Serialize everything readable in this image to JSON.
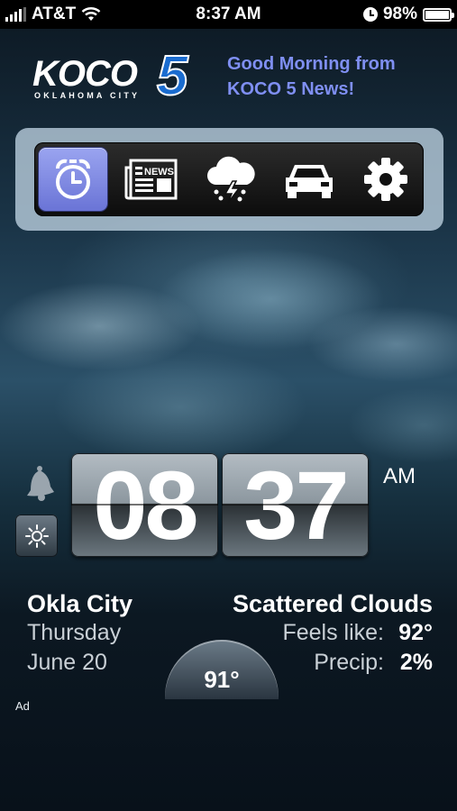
{
  "status_bar": {
    "carrier": "AT&T",
    "time": "8:37 AM",
    "battery": "98%",
    "battery_level": 0.98
  },
  "header": {
    "logo_text": "KOCO",
    "logo_number": "5",
    "logo_subtitle": "OKLAHOMA CITY",
    "greeting_line1": "Good Morning from",
    "greeting_line2": "KOCO 5 News!"
  },
  "nav": {
    "items": [
      {
        "icon": "alarm-clock-icon",
        "active": true
      },
      {
        "icon": "news-icon",
        "label": "NEWS",
        "active": false
      },
      {
        "icon": "storm-cloud-icon",
        "active": false
      },
      {
        "icon": "car-icon",
        "active": false
      },
      {
        "icon": "gear-icon",
        "active": false
      }
    ],
    "active_color": "#8a94ea"
  },
  "clock": {
    "hours": "08",
    "minutes": "37",
    "ampm": "AM"
  },
  "weather": {
    "city": "Okla City",
    "day": "Thursday",
    "date": "June 20",
    "condition": "Scattered Clouds",
    "feels_label": "Feels like:",
    "feels_value": "92°",
    "precip_label": "Precip:",
    "precip_value": "2%",
    "temperature": "91°"
  },
  "ad_label": "Ad"
}
